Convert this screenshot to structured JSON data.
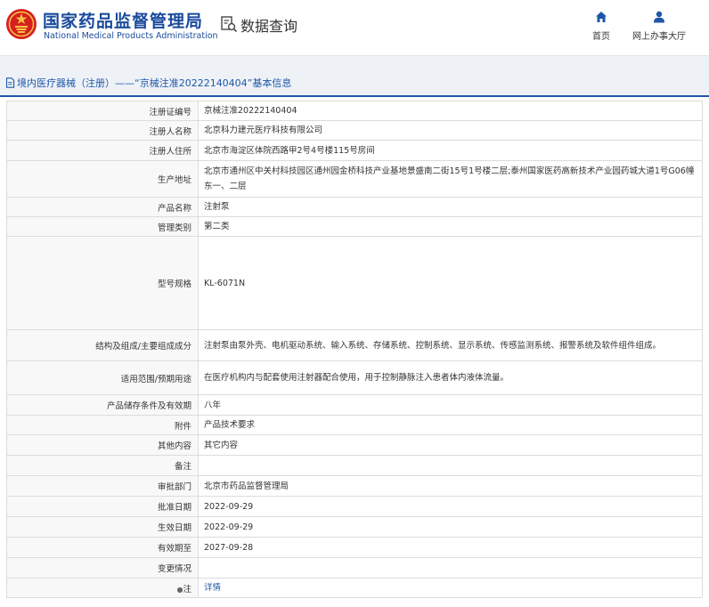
{
  "header": {
    "brand_cn": "国家药品监督管理局",
    "brand_en": "National Medical Products Administration",
    "query_title": "数据查询",
    "nav": {
      "home": "首页",
      "hall": "网上办事大厅"
    }
  },
  "colors": {
    "brand": "#1a4a9c",
    "accent": "#1f57a8",
    "emblem": "#d71f1f"
  },
  "section": {
    "title": "境内医疗器械（注册）——“京械注准20222140404”基本信息"
  },
  "rows": [
    {
      "label": "注册证编号",
      "value": "京械注准20222140404"
    },
    {
      "label": "注册人名称",
      "value": "北京科力建元医疗科技有限公司"
    },
    {
      "label": "注册人住所",
      "value": "北京市海淀区体院西路甲2号4号楼115号房间"
    },
    {
      "label": "生产地址",
      "value": "北京市通州区中关村科技园区通州园金桥科技产业基地景盛南二街15号1号楼二层;泰州国家医药高新技术产业园药城大道1号G06幢东一、二层"
    },
    {
      "label": "产品名称",
      "value": "注射泵"
    },
    {
      "label": "管理类别",
      "value": "第二类"
    },
    {
      "label": "型号规格",
      "value": "KL-6071N"
    },
    {
      "label": "结构及组成/主要组成成分",
      "value": "注射泵由泵外壳、电机驱动系统、输入系统、存储系统、控制系统、显示系统、传感监测系统、报警系统及软件组件组成。"
    },
    {
      "label": "适用范围/预期用途",
      "value": "在医疗机构内与配套使用注射器配合使用，用于控制静脉注入患者体内液体流量。"
    },
    {
      "label": "产品储存条件及有效期",
      "value": "八年"
    },
    {
      "label": "附件",
      "value": "产品技术要求"
    },
    {
      "label": "其他内容",
      "value": "其它内容"
    },
    {
      "label": "备注",
      "value": ""
    },
    {
      "label": "审批部门",
      "value": "北京市药品监督管理局"
    },
    {
      "label": "批准日期",
      "value": "2022-09-29"
    },
    {
      "label": "生效日期",
      "value": "2022-09-29"
    },
    {
      "label": "有效期至",
      "value": "2027-09-28"
    },
    {
      "label": "变更情况",
      "value": ""
    }
  ],
  "note": {
    "label": "注",
    "link": "详情",
    "icon": "info-dot-icon"
  }
}
